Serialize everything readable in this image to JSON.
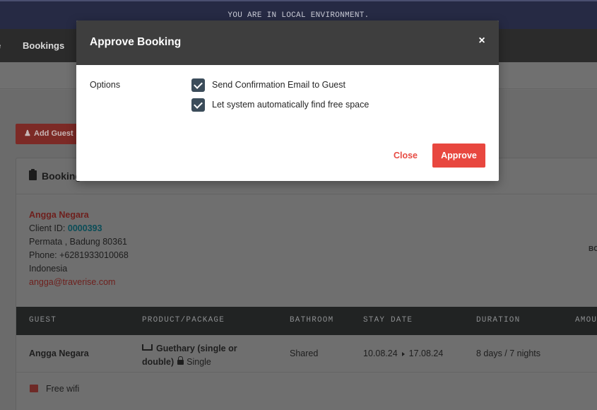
{
  "env_banner": "YOU ARE IN LOCAL ENVIRONMENT.",
  "navbar": {
    "prev_item": "e",
    "bookings": "Bookings"
  },
  "page": {
    "add_guest_label": "Add Guest",
    "card_title": "Booking",
    "client": {
      "name": "Angga Negara",
      "id_label": "Client ID:",
      "id_value": "0000393",
      "address": "Permata , Badung 80361",
      "phone": "Phone: +6281933010068",
      "country": "Indonesia",
      "email": "angga@traverise.com"
    },
    "right_cut_text": "BC",
    "table": {
      "headers": [
        "GUEST",
        "PRODUCT/PACKAGE",
        "BATHROOM",
        "STAY DATE",
        "DURATION",
        "AMOU"
      ],
      "row": {
        "guest": "Angga Negara",
        "product_line1": "Guethary (single or",
        "product_line2": "double)",
        "room_type": "Single",
        "bathroom": "Shared",
        "stay_from": "10.08.24",
        "stay_to": "17.08.24",
        "duration": "8 days / 7 nights"
      },
      "amenity": "Free wifi"
    }
  },
  "modal": {
    "title": "Approve Booking",
    "close_glyph": "×",
    "options_label": "Options",
    "options": [
      {
        "label": "Send Confirmation Email to Guest",
        "checked": true
      },
      {
        "label": "Let system automatically find free space",
        "checked": true
      }
    ],
    "close_button": "Close",
    "approve_button": "Approve"
  },
  "colors": {
    "accent_red": "#e8473f",
    "checkbox": "#3b4c5a",
    "modal_header": "#3e3e3e",
    "env_bar": "#262a44"
  }
}
